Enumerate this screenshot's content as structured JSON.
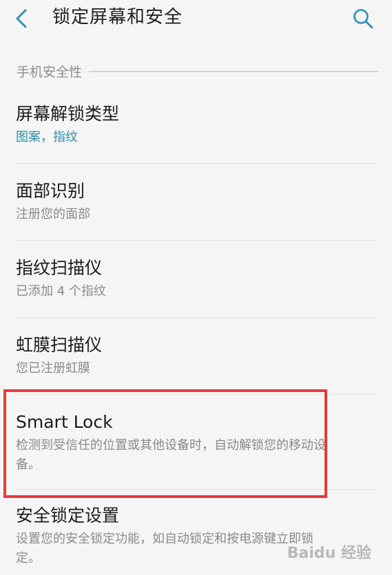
{
  "header": {
    "title": "锁定屏幕和安全",
    "back_icon": "back-arrow-icon",
    "search_icon": "search-icon"
  },
  "section": {
    "label": "手机安全性"
  },
  "items": [
    {
      "title": "屏幕解锁类型",
      "subtitle": "图案，指纹"
    },
    {
      "title": "面部识别",
      "subtitle": "注册您的面部"
    },
    {
      "title": "指纹扫描仪",
      "subtitle": "已添加 4 个指纹"
    },
    {
      "title": "虹膜扫描仪",
      "subtitle": "您已注册虹膜"
    },
    {
      "title": "Smart Lock",
      "subtitle": "检测到受信任的位置或其他设备时，自动解锁您的移动设备。"
    },
    {
      "title": "安全锁定设置",
      "subtitle": "设置您的安全锁定功能，如自动锁定和按电源键立即锁定。"
    }
  ],
  "colors": {
    "accent": "#2f8fb0",
    "highlight": "#e53a3e"
  },
  "watermark": "Baidu 经验"
}
